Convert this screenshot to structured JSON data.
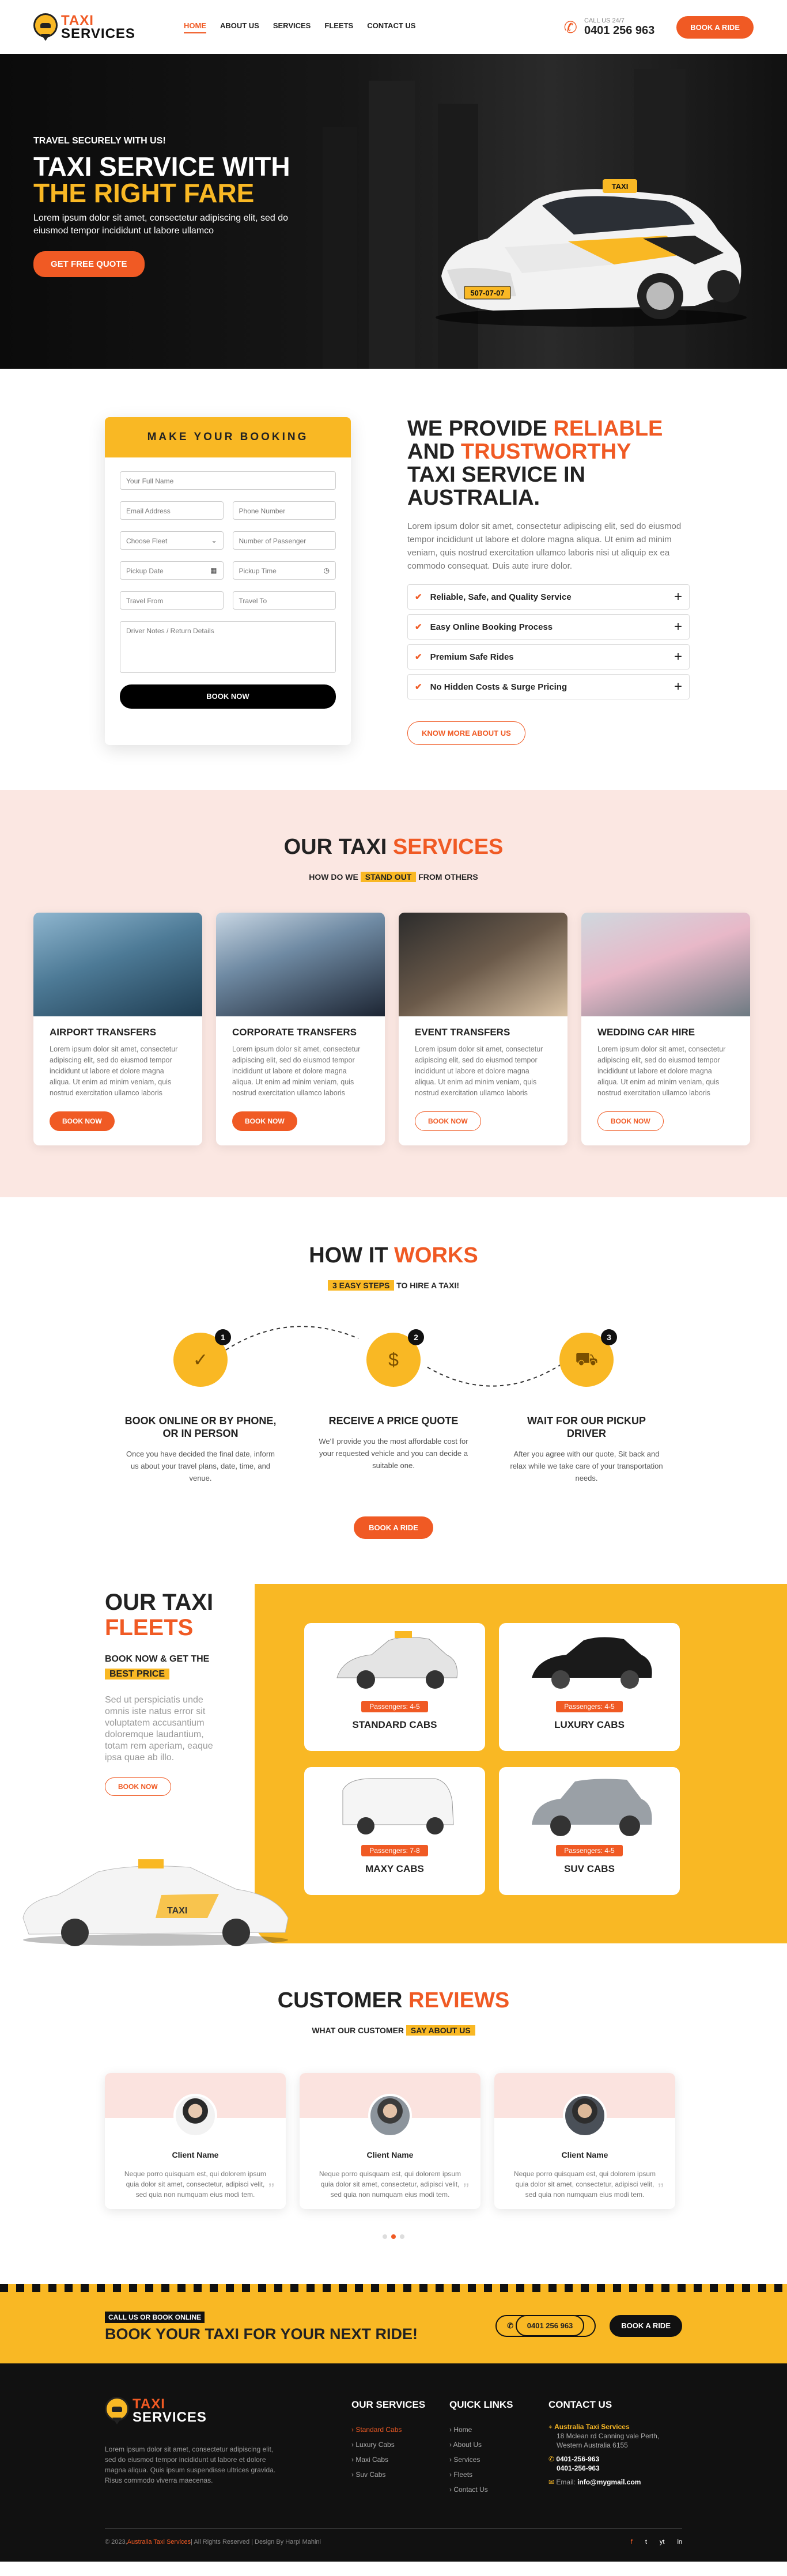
{
  "header": {
    "brand_top": "TAXI",
    "brand_bottom": "SERVICES",
    "nav": [
      "HOME",
      "ABOUT US",
      "SERVICES",
      "FLEETS",
      "CONTACT US"
    ],
    "call_label": "CALL US 24/7",
    "phone": "0401 256 963",
    "cta": "BOOK A RIDE"
  },
  "hero": {
    "tagline": "TRAVEL SECURELY WITH US!",
    "title1": "TAXI SERVICE WITH",
    "title2": "THE RIGHT FARE",
    "text": "Lorem ipsum dolor sit amet, consectetur adipiscing elit, sed do eiusmod tempor incididunt ut labore ullamco",
    "button": "GET FREE QUOTE",
    "plate": "507-07-07",
    "roof": "TAXI"
  },
  "booking": {
    "title": "MAKE YOUR BOOKING",
    "name": "Your Full Name",
    "email": "Email Address",
    "phone": "Phone Number",
    "fleet": "Choose Fleet",
    "passengers": "Number of Passenger",
    "date": "Pickup Date",
    "time": "Pickup Time",
    "from": "Travel From",
    "to": "Travel To",
    "notes": "Driver Notes / Return Details",
    "submit": "BOOK NOW"
  },
  "about": {
    "h_a": "WE PROVIDE ",
    "h_b": "RELIABLE",
    "h_c": "AND ",
    "h_d": "TRUSTWORTHY",
    "h_e": "TAXI SERVICE IN AUSTRALIA.",
    "text": "Lorem ipsum dolor sit amet, consectetur adipiscing elit, sed do eiusmod tempor incididunt ut labore et dolore magna aliqua. Ut enim ad minim veniam, quis nostrud exercitation ullamco laboris nisi ut aliquip ex ea commodo consequat. Duis aute irure dolor.",
    "items": [
      "Reliable, Safe, and Quality Service",
      "Easy Online Booking Process",
      "Premium Safe Rides",
      "No Hidden Costs & Surge Pricing"
    ],
    "button": "KNOW MORE ABOUT US"
  },
  "services": {
    "t1": "OUR TAXI ",
    "t2": "SERVICES",
    "s1": "HOW DO WE ",
    "s2": "STAND OUT",
    "s3": " FROM OTHERS",
    "cards": [
      {
        "title": "AIRPORT TRANSFERS",
        "text": "Lorem ipsum dolor sit amet, consectetur adipiscing elit, sed do eiusmod tempor incididunt ut labore et dolore magna aliqua. Ut enim ad minim veniam, quis nostrud exercitation ullamco laboris",
        "btn": "BOOK NOW"
      },
      {
        "title": "CORPORATE TRANSFERS",
        "text": "Lorem ipsum dolor sit amet, consectetur adipiscing elit, sed do eiusmod tempor incididunt ut labore et dolore magna aliqua. Ut enim ad minim veniam, quis nostrud exercitation ullamco laboris",
        "btn": "BOOK NOW"
      },
      {
        "title": "EVENT TRANSFERS",
        "text": "Lorem ipsum dolor sit amet, consectetur adipiscing elit, sed do eiusmod tempor incididunt ut labore et dolore magna aliqua. Ut enim ad minim veniam, quis nostrud exercitation ullamco laboris",
        "btn": "BOOK NOW"
      },
      {
        "title": "WEDDING CAR HIRE",
        "text": "Lorem ipsum dolor sit amet, consectetur adipiscing elit, sed do eiusmod tempor incididunt ut labore et dolore magna aliqua. Ut enim ad minim veniam, quis nostrud exercitation ullamco laboris",
        "btn": "BOOK NOW"
      }
    ]
  },
  "how": {
    "t1": "HOW IT ",
    "t2": "WORKS",
    "s1": "3 EASY STEPS",
    "s2": " TO HIRE A TAXI!",
    "steps": [
      {
        "n": "1",
        "title": "BOOK ONLINE OR BY PHONE, OR IN PERSON",
        "text": "Once you have decided the final date, inform us about your travel plans, date, time, and venue."
      },
      {
        "n": "2",
        "title": "RECEIVE A PRICE QUOTE",
        "text": "We'll provide you the most affordable cost for your requested vehicle and you can decide a suitable one."
      },
      {
        "n": "3",
        "title": "WAIT FOR OUR PICKUP DRIVER",
        "text": "After you agree with our quote, Sit back and relax while we take care of your transportation needs."
      }
    ],
    "button": "BOOK A RIDE"
  },
  "fleets": {
    "t1": "OUR TAXI",
    "t2": "FLEETS",
    "s1": "BOOK NOW & GET THE",
    "s2": "BEST PRICE",
    "text": "Sed ut perspiciatis unde omnis iste natus error sit voluptatem accusantium doloremque laudantium, totam rem aperiam, eaque ipsa quae ab illo.",
    "button": "BOOK NOW",
    "cars": [
      {
        "name": "STANDARD CABS",
        "pass": "Passengers: 4-5"
      },
      {
        "name": "LUXURY CABS",
        "pass": "Passengers: 4-5"
      },
      {
        "name": "MAXY CABS",
        "pass": "Passengers: 7-8"
      },
      {
        "name": "SUV CABS",
        "pass": "Passengers: 4-5"
      }
    ],
    "decal": "TAXI"
  },
  "reviews": {
    "t1": "CUSTOMER ",
    "t2": "REVIEWS",
    "s1": "WHAT OUR CUSTOMER ",
    "s2": "SAY ABOUT US",
    "items": [
      {
        "name": "Client Name",
        "text": "Neque porro quisquam est, qui dolorem ipsum quia dolor sit amet, consectetur, adipisci velit, sed quia non numquam eius modi tem."
      },
      {
        "name": "Client Name",
        "text": "Neque porro quisquam est, qui dolorem ipsum quia dolor sit amet, consectetur, adipisci velit, sed quia non numquam eius modi tem."
      },
      {
        "name": "Client Name",
        "text": "Neque porro quisquam est, qui dolorem ipsum quia dolor sit amet, consectetur, adipisci velit, sed quia non numquam eius modi tem."
      }
    ]
  },
  "cta": {
    "small": "CALL US OR BOOK ONLINE",
    "big": "BOOK YOUR TAXI FOR YOUR NEXT RIDE!",
    "phone": "0401 256 963",
    "button": "BOOK A RIDE"
  },
  "footer": {
    "about": "Lorem ipsum dolor sit amet, consectetur adipiscing elit, sed do eiusmod tempor incididunt ut labore et dolore magna aliqua. Quis ipsum suspendisse ultrices gravida. Risus commodo viverra maecenas.",
    "services_title": "OUR SERVICES",
    "services": [
      "Standard Cabs",
      "Luxury Cabs",
      "Maxi Cabs",
      "Suv Cabs"
    ],
    "links_title": "QUICK LINKS",
    "links": [
      "Home",
      "About Us",
      "Services",
      "Fleets",
      "Contact Us"
    ],
    "contact_title": "CONTACT US",
    "company": "Australia Taxi Services",
    "address": "18 Mclean rd Canning vale Perth, Western Australia 6155",
    "phone1": "0401-256-963",
    "phone2": "0401-256-963",
    "email_label": "Email: ",
    "email": "info@mygmail.com",
    "copy_a": "© 2023, ",
    "copy_b": "Australia Taxi Services",
    "copy_c": " | All Rights Reserved | Design By Harpi Mahini",
    "social": [
      "f",
      "t",
      "yt",
      "in"
    ]
  },
  "colors": {
    "orange": "#f05a24",
    "yellow": "#f9b824",
    "dark": "#111111"
  }
}
